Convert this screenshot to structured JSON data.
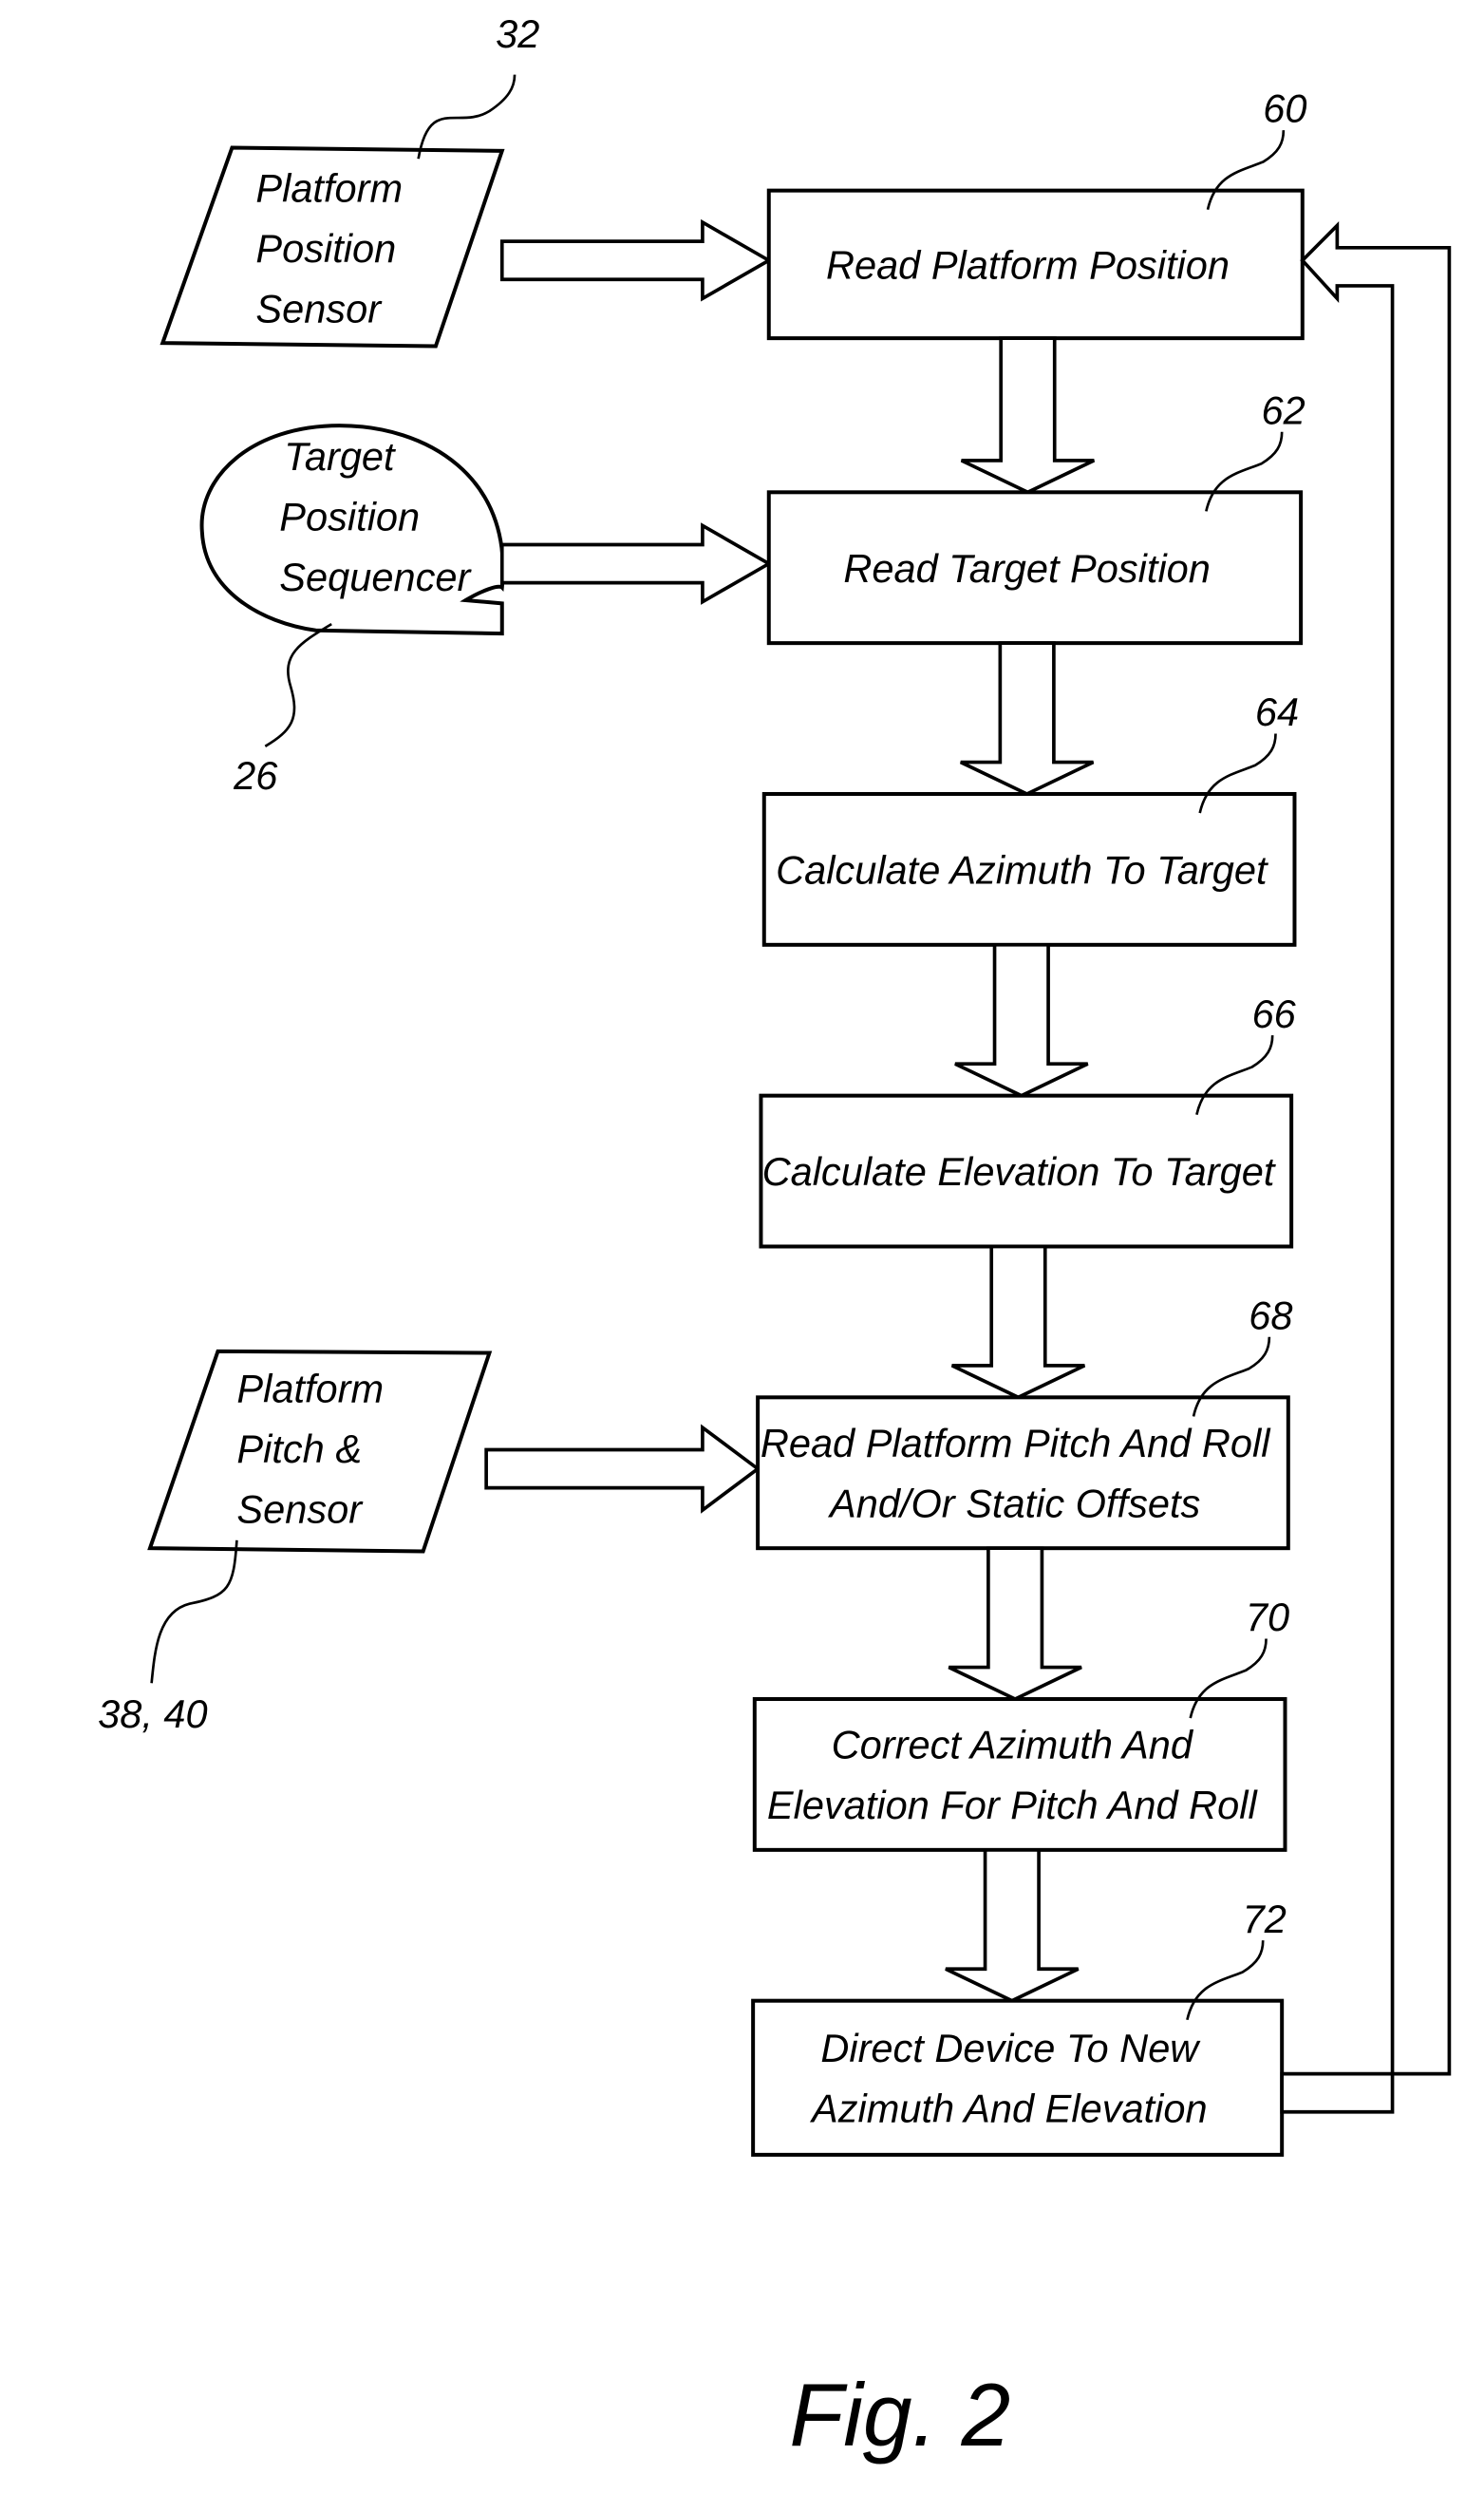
{
  "figure": {
    "caption": "Fig. 2",
    "inputs": [
      {
        "ref": "32",
        "shape": "parallelogram",
        "lines": [
          "Platform",
          "Position",
          "Sensor"
        ]
      },
      {
        "ref": "26",
        "shape": "ellipse-storage",
        "lines": [
          "Target",
          "Position",
          "Sequencer"
        ]
      },
      {
        "ref": "38, 40",
        "shape": "parallelogram",
        "lines": [
          "Platform",
          "Pitch &",
          "Sensor"
        ]
      }
    ],
    "steps": [
      {
        "ref": "60",
        "lines": [
          "Read Platform Position"
        ]
      },
      {
        "ref": "62",
        "lines": [
          "Read Target Position"
        ]
      },
      {
        "ref": "64",
        "lines": [
          "Calculate Azimuth To Target"
        ]
      },
      {
        "ref": "66",
        "lines": [
          "Calculate Elevation To Target"
        ]
      },
      {
        "ref": "68",
        "lines": [
          "Read Platform Pitch And Roll",
          "And/Or Static Offsets"
        ]
      },
      {
        "ref": "70",
        "lines": [
          "Correct Azimuth And",
          "Elevation For Pitch And Roll"
        ]
      },
      {
        "ref": "72",
        "lines": [
          "Direct Device To New",
          "Azimuth And Elevation"
        ]
      }
    ],
    "connections": [
      {
        "from": "32",
        "to": "60"
      },
      {
        "from": "26",
        "to": "62"
      },
      {
        "from": "38, 40",
        "to": "68"
      },
      {
        "from": "60",
        "to": "62"
      },
      {
        "from": "62",
        "to": "64"
      },
      {
        "from": "64",
        "to": "66"
      },
      {
        "from": "66",
        "to": "68"
      },
      {
        "from": "68",
        "to": "70"
      },
      {
        "from": "70",
        "to": "72"
      },
      {
        "from": "72",
        "to": "60",
        "type": "feedback-loop"
      }
    ]
  }
}
